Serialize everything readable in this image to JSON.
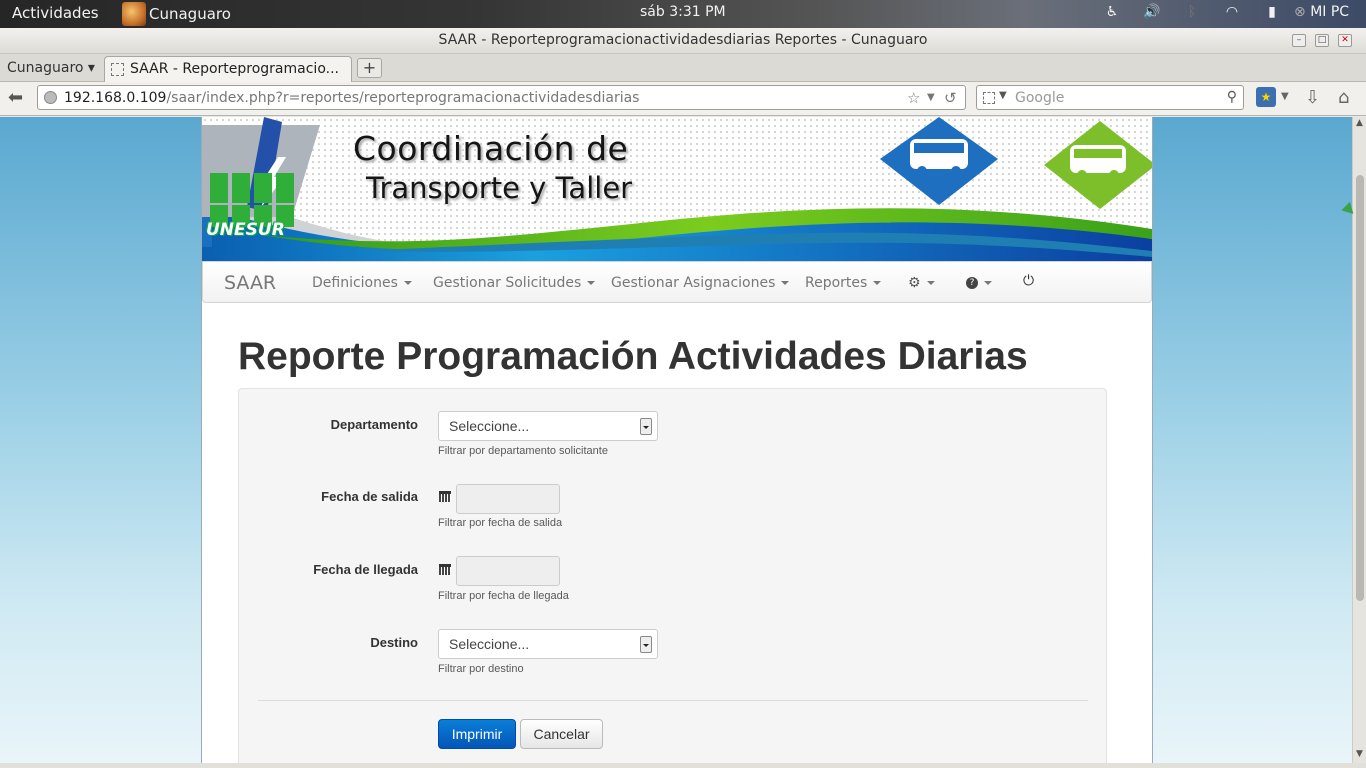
{
  "desktop": {
    "activities": "Actividades",
    "app_name": "Cunaguaro",
    "clock": "sáb  3:31 PM",
    "user": "MI PC"
  },
  "window": {
    "title": "SAAR - Reporteprogramacionactividadesdiarias Reportes - Cunaguaro"
  },
  "browser": {
    "tab_group": "Cunaguaro ▾",
    "tab_label": "SAAR - Reporteprogramacio...",
    "new_tab": "+",
    "url_host": "192.168.0.109",
    "url_path": "/saar/index.php?r=reportes/reporteprogramacionactividadesdiarias",
    "search_placeholder": "Google"
  },
  "banner": {
    "line1": "Coordinación de",
    "line2": "Transporte y Taller",
    "logo_text": "UNESUR"
  },
  "nav": {
    "brand": "SAAR",
    "items": [
      "Definiciones",
      "Gestionar Solicitudes",
      "Gestionar Asignaciones",
      "Reportes"
    ],
    "settings_icon": "cog-icon",
    "help_icon": "question-circle-icon",
    "logout_icon": "power-icon"
  },
  "page": {
    "title": "Reporte Programación Actividades Diarias"
  },
  "form": {
    "departamento": {
      "label": "Departamento",
      "value": "Seleccione...",
      "help": "Filtrar por departamento solicitante"
    },
    "fecha_salida": {
      "label": "Fecha de salida",
      "value": "",
      "help": "Filtrar por fecha de salida"
    },
    "fecha_llegada": {
      "label": "Fecha de llegada",
      "value": "",
      "help": "Filtrar por fecha de llegada"
    },
    "destino": {
      "label": "Destino",
      "value": "Seleccione...",
      "help": "Filtrar por destino"
    },
    "print_button": "Imprimir",
    "cancel_button": "Cancelar"
  },
  "colors": {
    "primary_button": "#0455b8",
    "page_background": "#5aa8d0"
  }
}
